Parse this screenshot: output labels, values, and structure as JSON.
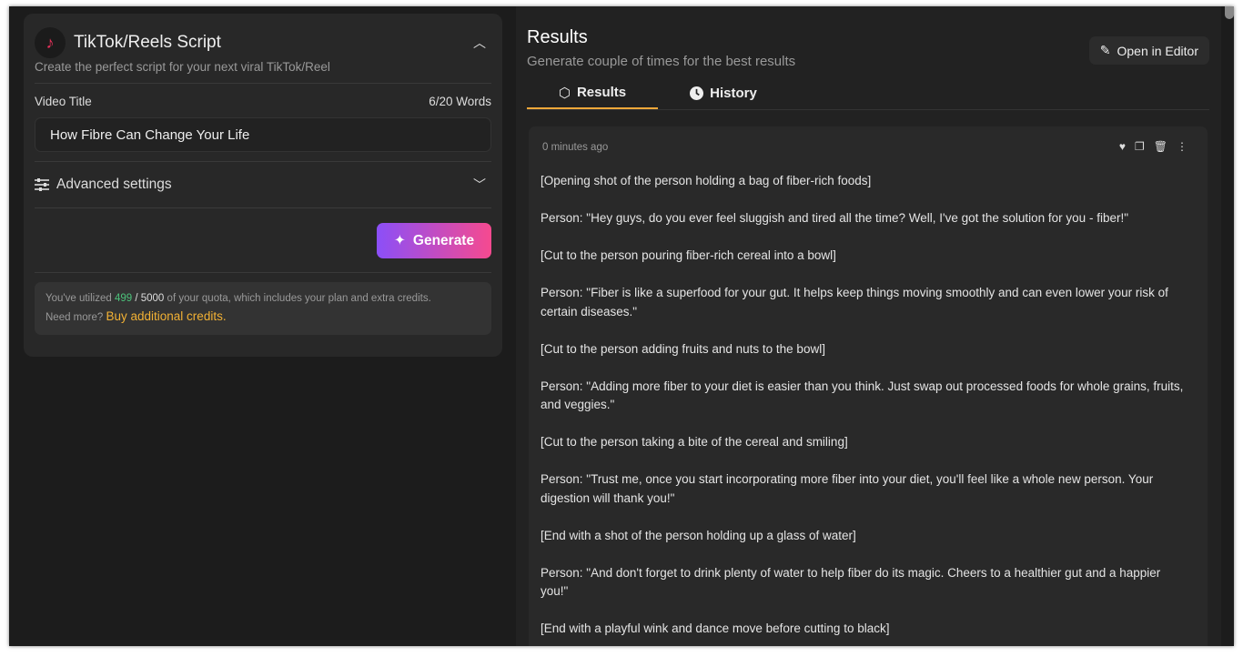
{
  "left": {
    "title": "TikTok/Reels Script",
    "subtitle": "Create the perfect script for your next viral TikTok/Reel",
    "field_label": "Video Title",
    "word_count": "6/20 Words",
    "field_value": "How Fibre Can Change Your Life",
    "advanced": "Advanced settings",
    "generate": "Generate",
    "quota": {
      "prefix": "You've utilized",
      "used": "499",
      "sep": "/",
      "total": "5000",
      "suffix": "of your quota, which includes your plan and extra credits.",
      "need": "Need more?",
      "link": "Buy additional credits."
    }
  },
  "right": {
    "title": "Results",
    "subtitle": "Generate couple of times for the best results",
    "open_editor": "Open in Editor",
    "tabs": [
      {
        "label": "Results",
        "active": true
      },
      {
        "label": "History",
        "active": false
      }
    ],
    "result": {
      "time": "0 minutes ago",
      "paragraphs": [
        "[Opening shot of the person holding a bag of fiber-rich foods]",
        "Person: \"Hey guys, do you ever feel sluggish and tired all the time? Well, I've got the solution for you - fiber!\"",
        "[Cut to the person pouring fiber-rich cereal into a bowl]",
        "Person: \"Fiber is like a superfood for your gut. It helps keep things moving smoothly and can even lower your risk of certain diseases.\"",
        "[Cut to the person adding fruits and nuts to the bowl]",
        "Person: \"Adding more fiber to your diet is easier than you think. Just swap out processed foods for whole grains, fruits, and veggies.\"",
        "[Cut to the person taking a bite of the cereal and smiling]",
        "Person: \"Trust me, once you start incorporating more fiber into your diet, you'll feel like a whole new person. Your digestion will thank you!\"",
        "[End with a shot of the person holding up a glass of water]",
        "Person: \"And don't forget to drink plenty of water to help fiber do its magic. Cheers to a healthier gut and a happier you!\"",
        "[End with a playful wink and dance move before cutting to black]"
      ]
    }
  },
  "colors": {
    "accent": "#f2a83a",
    "tiktok": "#e8315a",
    "green": "#4cc17a",
    "gradient_start": "#8b4ff8",
    "gradient_end": "#f64a8f"
  }
}
